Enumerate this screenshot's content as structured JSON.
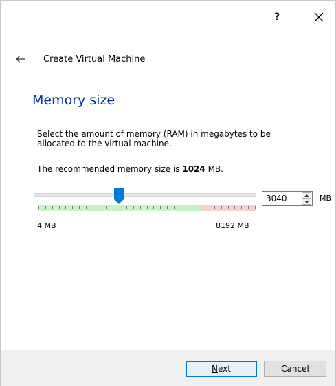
{
  "window": {
    "help_label": "?",
    "close_icon": "close-icon"
  },
  "nav": {
    "back_icon": "back-arrow-icon",
    "wizard_title": "Create Virtual Machine"
  },
  "page": {
    "title": "Memory size",
    "description": "Select the amount of memory (RAM) in megabytes to be allocated to the virtual machine.",
    "recommend_prefix": "The recommended memory size is ",
    "recommend_value": "1024",
    "recommend_suffix": " MB."
  },
  "memory": {
    "value": "3040",
    "unit": "MB",
    "min_label": "4 MB",
    "max_label": "8192 MB",
    "min_mb": 4,
    "max_mb": 8192,
    "current_mb": 3040,
    "safe_limit_mb": 6144,
    "tick_count": 33
  },
  "buttons": {
    "next_mnemonic": "N",
    "next_rest": "ext",
    "cancel": "Cancel"
  },
  "colors": {
    "title": "#003399",
    "accent": "#0078d7",
    "safe_zone": "#c6f4c6",
    "danger_zone": "#f7d1d1"
  }
}
